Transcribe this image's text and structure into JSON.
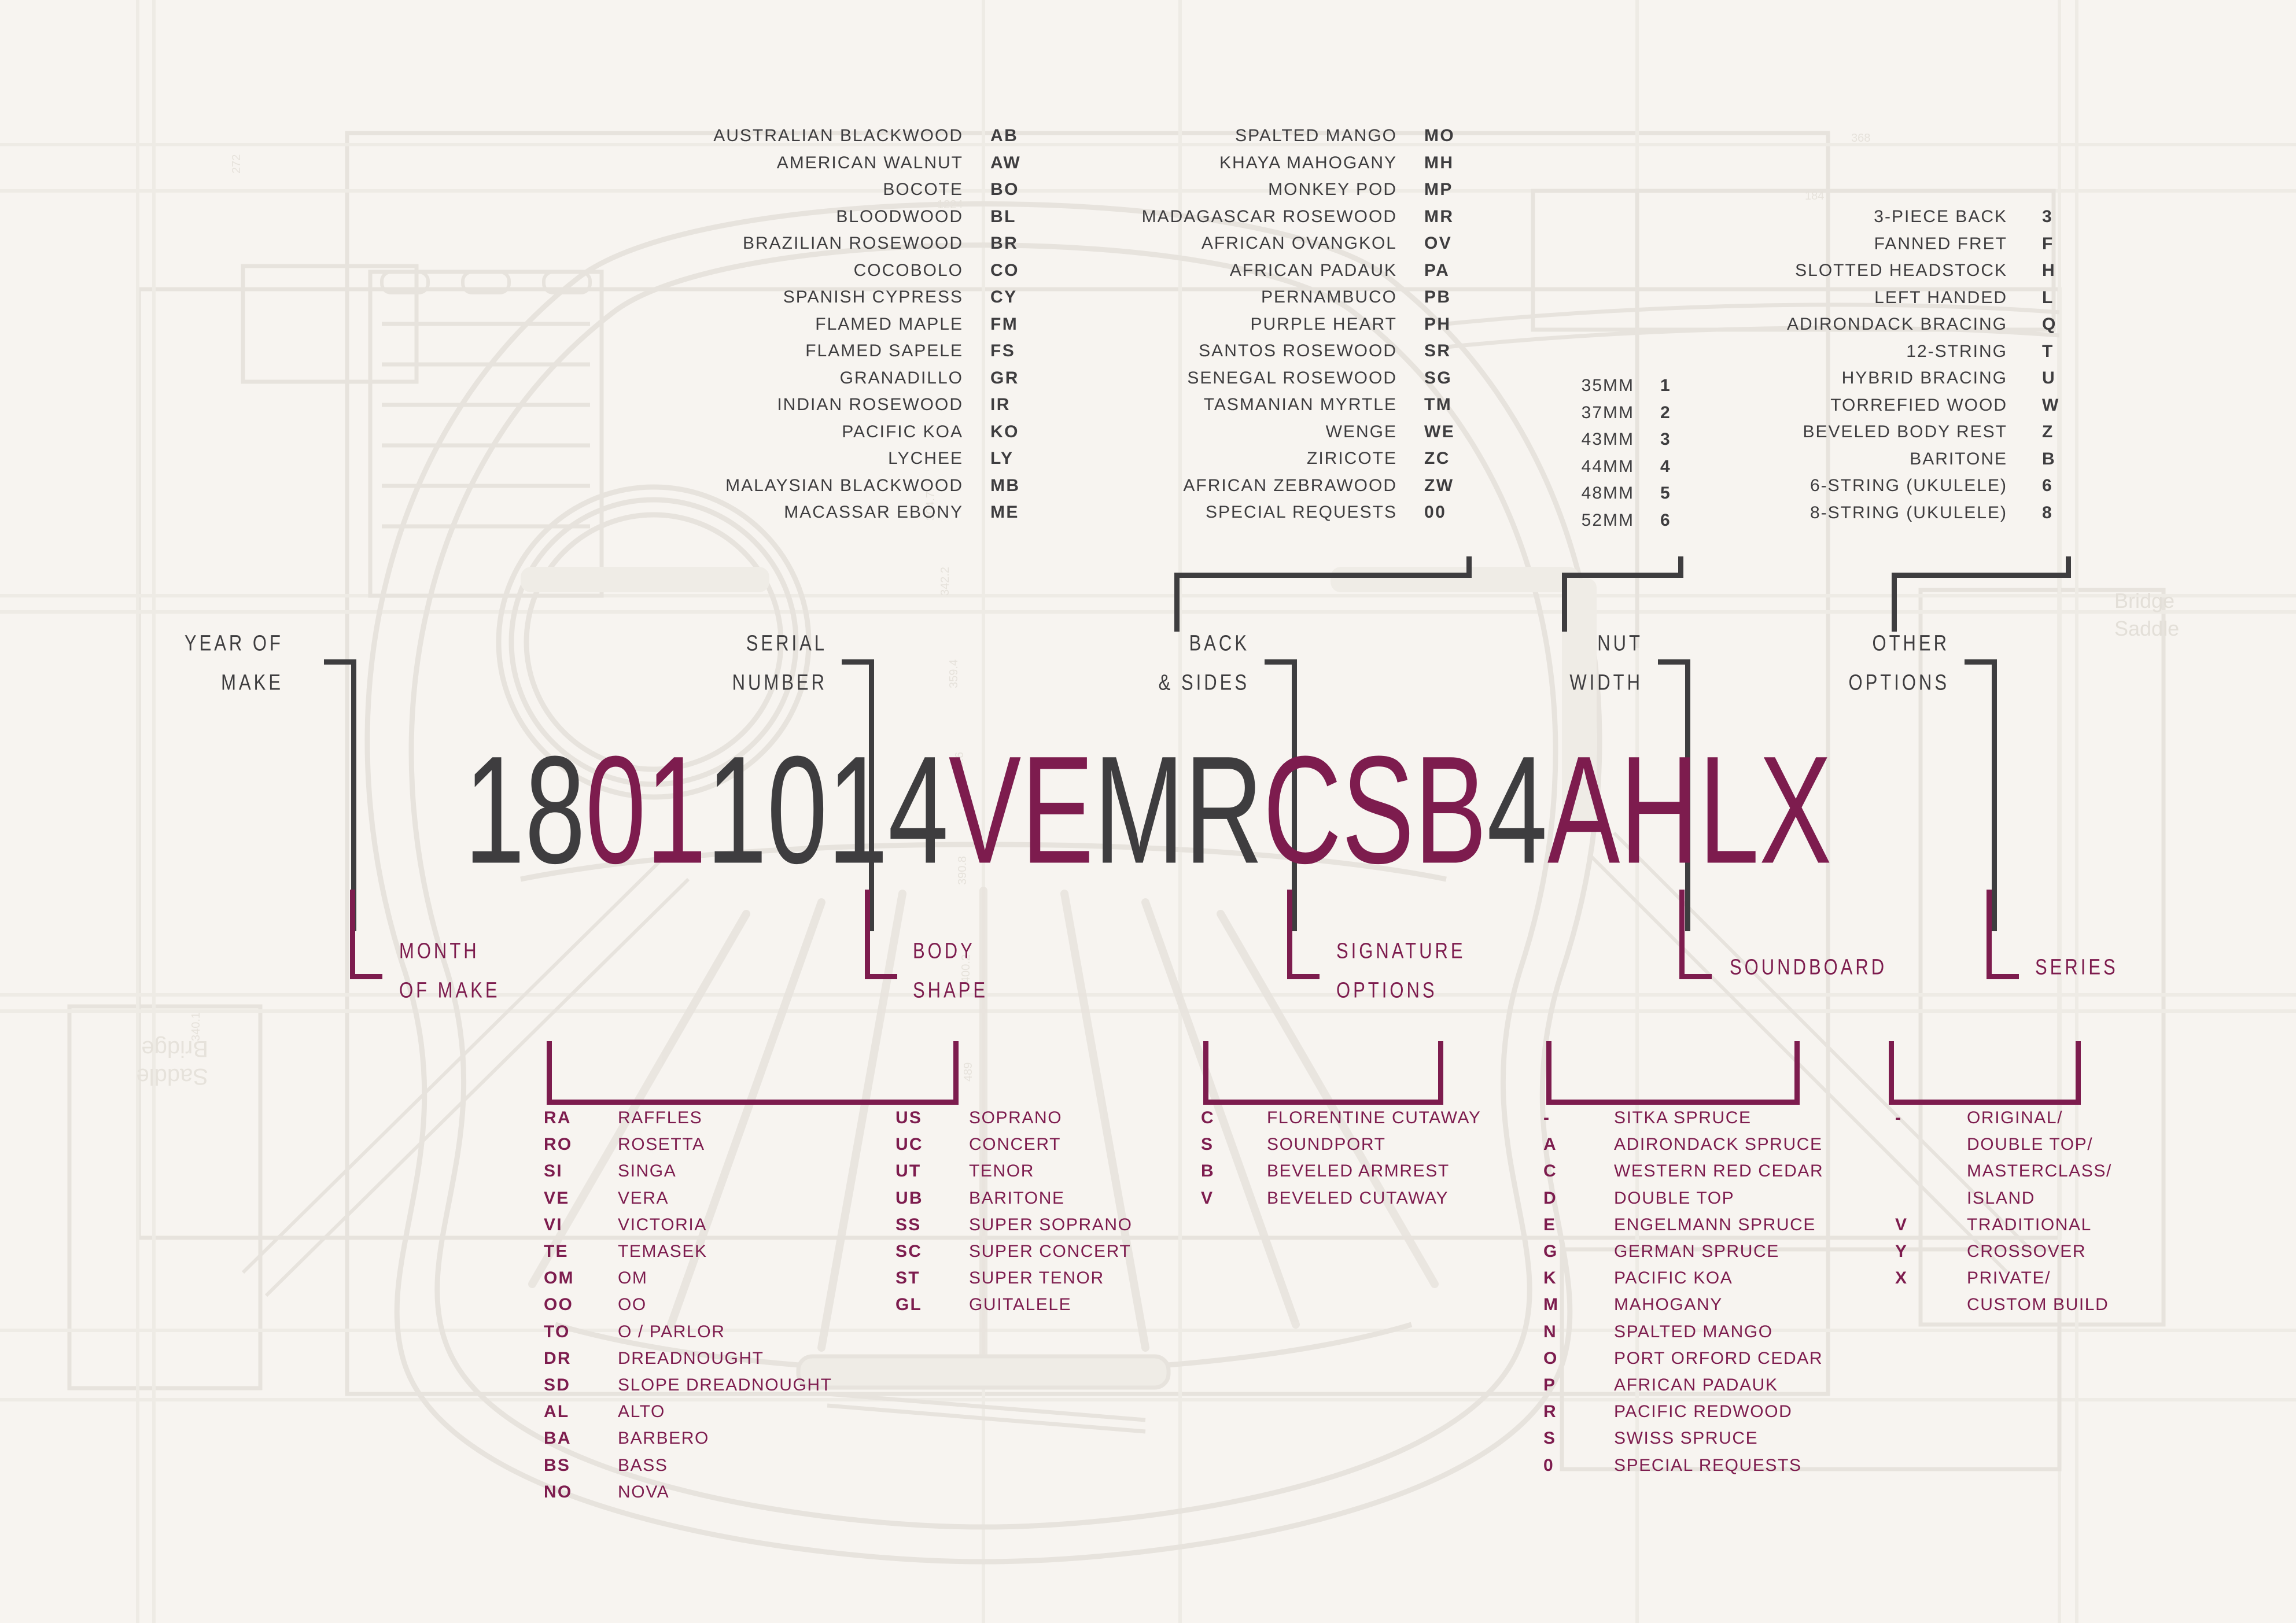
{
  "colors": {
    "background": "#f7f4f0",
    "dark": "#3e3d3f",
    "maroon": "#7d1c4e",
    "blueprint": "#e7e3dd"
  },
  "serial": {
    "full": "18011014VEMRCSB4AHLX",
    "segments": [
      {
        "text": "18",
        "color": "dark",
        "meaning": "year-of-make"
      },
      {
        "text": "01",
        "color": "maroon",
        "meaning": "month-of-make"
      },
      {
        "text": "1014",
        "color": "dark",
        "meaning": "serial-number"
      },
      {
        "text": "VE",
        "color": "maroon",
        "meaning": "body-shape"
      },
      {
        "text": "MR",
        "color": "dark",
        "meaning": "back-and-sides"
      },
      {
        "text": "CSB",
        "color": "maroon",
        "meaning": "signature-options"
      },
      {
        "text": "4",
        "color": "dark",
        "meaning": "nut-width"
      },
      {
        "text": "AHL",
        "color": "maroon",
        "meaning": "other-options"
      },
      {
        "text": "X",
        "color": "maroon",
        "meaning": "series"
      }
    ]
  },
  "leaders": {
    "year_of_make": "YEAR OF\nMAKE",
    "year_of_make_l1": "YEAR OF",
    "year_of_make_l2": "MAKE",
    "serial_number_l1": "SERIAL",
    "serial_number_l2": "NUMBER",
    "back_and_sides_l1": "BACK",
    "back_and_sides_l2": "& SIDES",
    "nut_width_l1": "NUT",
    "nut_width_l2": "WIDTH",
    "other_options_l1": "OTHER",
    "other_options_l2": "OPTIONS",
    "month_of_make_l1": "MONTH",
    "month_of_make_l2": "OF MAKE",
    "body_shape_l1": "BODY",
    "body_shape_l2": "SHAPE",
    "signature_options_l1": "SIGNATURE",
    "signature_options_l2": "OPTIONS",
    "soundboard": "SOUNDBOARD",
    "series": "SERIES"
  },
  "back_and_sides": {
    "column1": [
      {
        "name": "AUSTRALIAN BLACKWOOD",
        "code": "AB"
      },
      {
        "name": "AMERICAN WALNUT",
        "code": "AW"
      },
      {
        "name": "BOCOTE",
        "code": "BO"
      },
      {
        "name": "BLOODWOOD",
        "code": "BL"
      },
      {
        "name": "BRAZILIAN ROSEWOOD",
        "code": "BR"
      },
      {
        "name": "COCOBOLO",
        "code": "CO"
      },
      {
        "name": "SPANISH CYPRESS",
        "code": "CY"
      },
      {
        "name": "FLAMED MAPLE",
        "code": "FM"
      },
      {
        "name": "FLAMED SAPELE",
        "code": "FS"
      },
      {
        "name": "GRANADILLO",
        "code": "GR"
      },
      {
        "name": "INDIAN ROSEWOOD",
        "code": "IR"
      },
      {
        "name": "PACIFIC KOA",
        "code": "KO"
      },
      {
        "name": "LYCHEE",
        "code": "LY"
      },
      {
        "name": "MALAYSIAN BLACKWOOD",
        "code": "MB"
      },
      {
        "name": "MACASSAR EBONY",
        "code": "ME"
      }
    ],
    "column2": [
      {
        "name": "SPALTED MANGO",
        "code": "MO"
      },
      {
        "name": "KHAYA MAHOGANY",
        "code": "MH"
      },
      {
        "name": "MONKEY POD",
        "code": "MP"
      },
      {
        "name": "MADAGASCAR ROSEWOOD",
        "code": "MR"
      },
      {
        "name": "AFRICAN OVANGKOL",
        "code": "OV"
      },
      {
        "name": "AFRICAN PADAUK",
        "code": "PA"
      },
      {
        "name": "PERNAMBUCO",
        "code": "PB"
      },
      {
        "name": "PURPLE HEART",
        "code": "PH"
      },
      {
        "name": "SANTOS ROSEWOOD",
        "code": "SR"
      },
      {
        "name": "SENEGAL ROSEWOOD",
        "code": "SG"
      },
      {
        "name": "TASMANIAN MYRTLE",
        "code": "TM"
      },
      {
        "name": "WENGE",
        "code": "WE"
      },
      {
        "name": "ZIRICOTE",
        "code": "ZC"
      },
      {
        "name": "AFRICAN ZEBRAWOOD",
        "code": "ZW"
      },
      {
        "name": "SPECIAL REQUESTS",
        "code": "00"
      }
    ]
  },
  "nut_width": [
    {
      "name": "35MM",
      "code": "1"
    },
    {
      "name": "37MM",
      "code": "2"
    },
    {
      "name": "43MM",
      "code": "3"
    },
    {
      "name": "44MM",
      "code": "4"
    },
    {
      "name": "48MM",
      "code": "5"
    },
    {
      "name": "52MM",
      "code": "6"
    }
  ],
  "other_options": [
    {
      "name": "3-PIECE BACK",
      "code": "3"
    },
    {
      "name": "FANNED FRET",
      "code": "F"
    },
    {
      "name": "SLOTTED HEADSTOCK",
      "code": "H"
    },
    {
      "name": "LEFT HANDED",
      "code": "L"
    },
    {
      "name": "ADIRONDACK BRACING",
      "code": "Q"
    },
    {
      "name": "12-STRING",
      "code": "T"
    },
    {
      "name": "HYBRID BRACING",
      "code": "U"
    },
    {
      "name": "TORREFIED WOOD",
      "code": "W"
    },
    {
      "name": "BEVELED BODY REST",
      "code": "Z"
    },
    {
      "name": "BARITONE",
      "code": "B"
    },
    {
      "name": "6-STRING (UKULELE)",
      "code": "6"
    },
    {
      "name": "8-STRING (UKULELE)",
      "code": "8"
    }
  ],
  "body_shape": {
    "column1": [
      {
        "code": "RA",
        "name": "RAFFLES"
      },
      {
        "code": "RO",
        "name": "ROSETTA"
      },
      {
        "code": "SI",
        "name": "SINGA"
      },
      {
        "code": "VE",
        "name": "VERA"
      },
      {
        "code": "VI",
        "name": "VICTORIA"
      },
      {
        "code": "TE",
        "name": "TEMASEK"
      },
      {
        "code": "OM",
        "name": "OM"
      },
      {
        "code": "OO",
        "name": "OO"
      },
      {
        "code": "TO",
        "name": "O / PARLOR"
      },
      {
        "code": "DR",
        "name": "DREADNOUGHT"
      },
      {
        "code": "SD",
        "name": "SLOPE DREADNOUGHT"
      },
      {
        "code": "AL",
        "name": "ALTO"
      },
      {
        "code": "BA",
        "name": "BARBERO"
      },
      {
        "code": "BS",
        "name": "BASS"
      },
      {
        "code": "NO",
        "name": "NOVA"
      }
    ],
    "column2": [
      {
        "code": "US",
        "name": "SOPRANO"
      },
      {
        "code": "UC",
        "name": "CONCERT"
      },
      {
        "code": "UT",
        "name": "TENOR"
      },
      {
        "code": "UB",
        "name": "BARITONE"
      },
      {
        "code": "SS",
        "name": "SUPER SOPRANO"
      },
      {
        "code": "SC",
        "name": "SUPER CONCERT"
      },
      {
        "code": "ST",
        "name": "SUPER TENOR"
      },
      {
        "code": "GL",
        "name": "GUITALELE"
      }
    ]
  },
  "signature_options": [
    {
      "code": "C",
      "name": "FLORENTINE CUTAWAY"
    },
    {
      "code": "S",
      "name": "SOUNDPORT"
    },
    {
      "code": "B",
      "name": "BEVELED ARMREST"
    },
    {
      "code": "V",
      "name": "BEVELED CUTAWAY"
    }
  ],
  "soundboard": [
    {
      "code": "-",
      "name": "SITKA SPRUCE"
    },
    {
      "code": "A",
      "name": "ADIRONDACK SPRUCE"
    },
    {
      "code": "C",
      "name": "WESTERN RED CEDAR"
    },
    {
      "code": "D",
      "name": "DOUBLE TOP"
    },
    {
      "code": "E",
      "name": "ENGELMANN SPRUCE"
    },
    {
      "code": "G",
      "name": "GERMAN SPRUCE"
    },
    {
      "code": "K",
      "name": "PACIFIC KOA"
    },
    {
      "code": "M",
      "name": "MAHOGANY"
    },
    {
      "code": "N",
      "name": "SPALTED MANGO"
    },
    {
      "code": "O",
      "name": "PORT ORFORD CEDAR"
    },
    {
      "code": "P",
      "name": "AFRICAN PADAUK"
    },
    {
      "code": "R",
      "name": "PACIFIC REDWOOD"
    },
    {
      "code": "S",
      "name": "SWISS SPRUCE"
    },
    {
      "code": "0",
      "name": "SPECIAL REQUESTS"
    }
  ],
  "series": {
    "codes": [
      "-",
      "V",
      "Y",
      "X"
    ],
    "names": [
      "ORIGINAL/",
      "DOUBLE TOP/",
      "MASTERCLASS/",
      "ISLAND",
      "TRADITIONAL",
      "CROSSOVER",
      "PRIVATE/",
      "CUSTOM BUILD"
    ],
    "code_rows": [
      {
        "code": "-",
        "row": 0
      },
      {
        "code": "V",
        "row": 4
      },
      {
        "code": "Y",
        "row": 5
      },
      {
        "code": "X",
        "row": 6
      }
    ]
  },
  "blueprint_labels": {
    "bridge_saddle_right_l1": "Bridge",
    "bridge_saddle_right_l2": "Saddle",
    "bridge_saddle_left_l1": "Saddle",
    "bridge_saddle_left_l2": "Bridge"
  }
}
